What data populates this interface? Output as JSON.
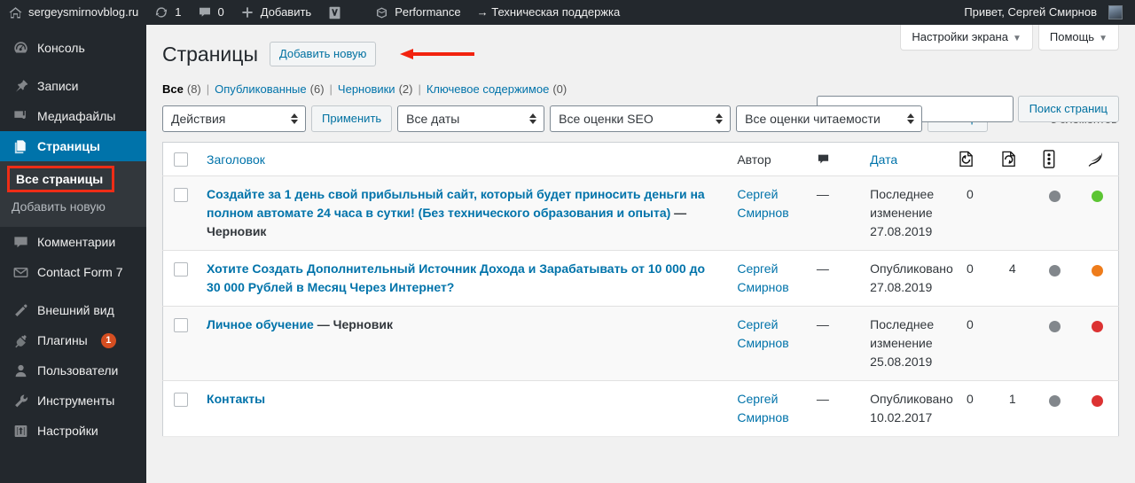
{
  "adminbar": {
    "site_name": "sergeysmirnovblog.ru",
    "updates_count": "1",
    "comments_count": "0",
    "new_label": "Добавить",
    "yoast_label": "Y",
    "performance_label": "Performance",
    "support_label": "→ Техническая поддержка",
    "howdy": "Привет, Сергей Смирнов"
  },
  "sidebar": {
    "items": [
      {
        "label": "Консоль",
        "icon": "dashboard-icon",
        "name": "sidebar-item-dashboard"
      },
      {
        "label": "Записи",
        "icon": "pin-icon",
        "name": "sidebar-item-posts"
      },
      {
        "label": "Медиафайлы",
        "icon": "media-icon",
        "name": "sidebar-item-media"
      },
      {
        "label": "Страницы",
        "icon": "pages-icon",
        "name": "sidebar-item-pages"
      },
      {
        "label": "Комментарии",
        "icon": "comment-icon",
        "name": "sidebar-item-comments"
      },
      {
        "label": "Contact Form 7",
        "icon": "envelope-icon",
        "name": "sidebar-item-contact-form-7"
      },
      {
        "label": "Внешний вид",
        "icon": "brush-icon",
        "name": "sidebar-item-appearance"
      },
      {
        "label": "Плагины",
        "icon": "plug-icon",
        "name": "sidebar-item-plugins",
        "badge": "1"
      },
      {
        "label": "Пользователи",
        "icon": "user-icon",
        "name": "sidebar-item-users"
      },
      {
        "label": "Инструменты",
        "icon": "wrench-icon",
        "name": "sidebar-item-tools"
      },
      {
        "label": "Настройки",
        "icon": "settings-icon",
        "name": "sidebar-item-settings"
      }
    ],
    "submenu": {
      "all_pages": "Все страницы",
      "add_new": "Добавить новую"
    }
  },
  "screen_meta": {
    "screen_options": "Настройки экрана",
    "help": "Помощь",
    "caret": "▼"
  },
  "page": {
    "title": "Страницы",
    "add_new": "Добавить новую"
  },
  "filters": [
    {
      "label": "Все",
      "count": "(8)",
      "current": true
    },
    {
      "label": "Опубликованные",
      "count": "(6)",
      "current": false
    },
    {
      "label": "Черновики",
      "count": "(2)",
      "current": false
    },
    {
      "label": "Ключевое содержимое",
      "count": "(0)",
      "current": false
    }
  ],
  "search": {
    "value": "",
    "placeholder": "",
    "button": "Поиск страниц"
  },
  "tablenav": {
    "bulk_actions": "Действия",
    "apply": "Применить",
    "all_dates": "Все даты",
    "all_seo": "Все оценки SEO",
    "all_readability": "Все оценки читаемости",
    "filter": "Фильтр",
    "displaying_num": "8 элементов"
  },
  "table": {
    "headers": {
      "title": "Заголовок",
      "author": "Автор",
      "comments_icon": "comment-bubble-icon",
      "date": "Дата",
      "icon1": "page-import-icon",
      "icon2": "page-export-icon",
      "icon3": "vertical-dots-icon",
      "icon4": "feather-icon"
    },
    "rows": [
      {
        "title": "Создайте за 1 день свой прибыльный сайт, который будет приносить деньги на полном автомате 24 часа в сутки! (Без технического образования и опыта)",
        "state": "— Черновик",
        "author": "Сергей Смирнов",
        "comments": "—",
        "date": "Последнее изменение 27.08.2019",
        "col1": "0",
        "col2": "",
        "seo_color": "#82878c",
        "read_color": "#5cc533"
      },
      {
        "title": "Хотите Создать Дополнительный Источник Дохода и Зарабатывать от 10 000 до 30 000 Рублей в Месяц Через Интернет?",
        "state": "",
        "author": "Сергей Смирнов",
        "comments": "—",
        "date": "Опубликовано 27.08.2019",
        "col1": "0",
        "col2": "4",
        "seo_color": "#82878c",
        "read_color": "#ee7c1b"
      },
      {
        "title": "Личное обучение",
        "state": "— Черновик",
        "author": "Сергей Смирнов",
        "comments": "—",
        "date": "Последнее изменение 25.08.2019",
        "col1": "0",
        "col2": "",
        "seo_color": "#82878c",
        "read_color": "#dc3232"
      },
      {
        "title": "Контакты",
        "state": "",
        "author": "Сергей Смирнов",
        "comments": "—",
        "date": "Опубликовано 10.02.2017",
        "col1": "0",
        "col2": "1",
        "seo_color": "#82878c",
        "read_color": "#dc3232"
      }
    ]
  },
  "colors": {
    "admin_bar": "#23282d",
    "sidebar": "#23282d",
    "current_menu": "#0073aa",
    "link": "#0073aa",
    "annotation": "#f2230f"
  }
}
